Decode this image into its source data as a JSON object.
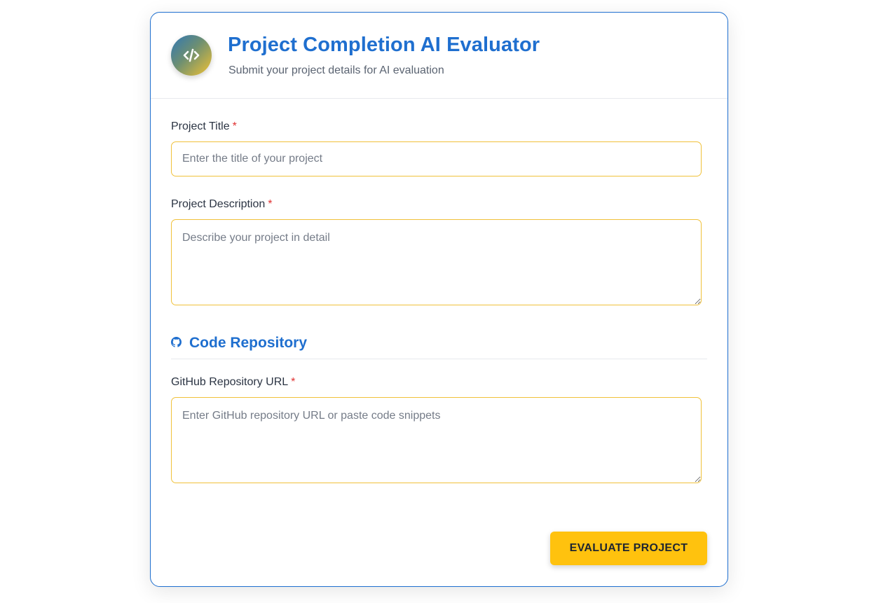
{
  "header": {
    "logo_icon": "code-icon",
    "title": "Project Completion AI Evaluator",
    "subtitle": "Submit your project details for AI evaluation"
  },
  "form": {
    "required_marker": "*",
    "project_title": {
      "label": "Project Title",
      "value": "",
      "placeholder": "Enter the title of your project"
    },
    "project_description": {
      "label": "Project Description",
      "value": "",
      "placeholder": "Describe your project in detail"
    },
    "repository_section": {
      "icon": "github-icon",
      "title": "Code Repository"
    },
    "github_url": {
      "label": "GitHub Repository URL",
      "value": "",
      "placeholder": "Enter GitHub repository URL or paste code snippets"
    },
    "submit_label": "EVALUATE PROJECT"
  },
  "colors": {
    "accent": "#1f6fcf",
    "button": "#ffc20e",
    "field_border": "#f0c13a",
    "required": "#e03131"
  }
}
